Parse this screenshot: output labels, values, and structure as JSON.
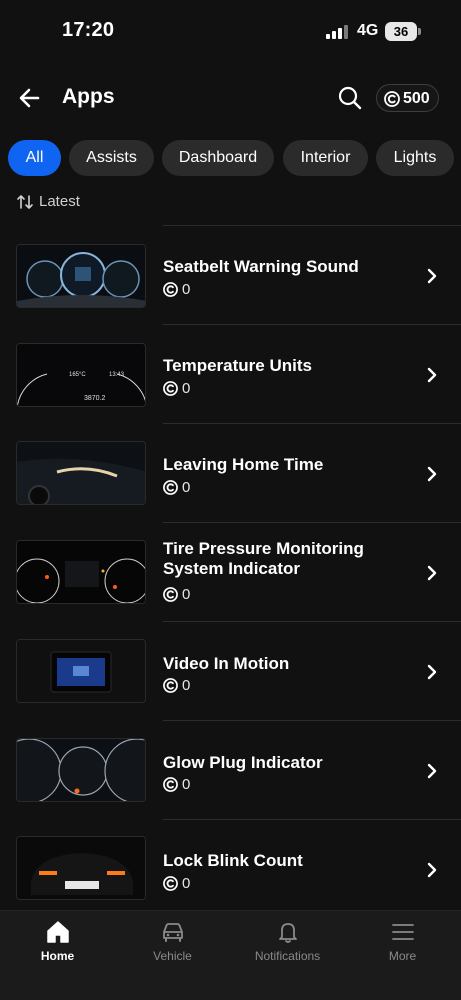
{
  "status_bar": {
    "time": "17:20",
    "network": "4G",
    "battery": "36"
  },
  "header": {
    "title": "Apps",
    "credits": "500",
    "icons": [
      "back-arrow-icon",
      "search-icon",
      "coin-icon"
    ]
  },
  "filters": [
    {
      "label": "All",
      "active": true
    },
    {
      "label": "Assists",
      "active": false
    },
    {
      "label": "Dashboard",
      "active": false
    },
    {
      "label": "Interior",
      "active": false
    },
    {
      "label": "Lights",
      "active": false
    }
  ],
  "sort": {
    "label": "Latest",
    "icon": "sort-arrows-icon"
  },
  "apps": [
    {
      "title": "Seatbelt Warning Sound",
      "price": "0"
    },
    {
      "title": "Temperature Units",
      "price": "0",
      "thumb_text": [
        "165°C",
        "13:43",
        "3870.2"
      ]
    },
    {
      "title": "Leaving Home Time",
      "price": "0"
    },
    {
      "title": "Tire Pressure Monitoring System Indicator",
      "price": "0"
    },
    {
      "title": "Video In Motion",
      "price": "0"
    },
    {
      "title": "Glow Plug Indicator",
      "price": "0"
    },
    {
      "title": "Lock  Blink  Count",
      "price": "0"
    }
  ],
  "bottom_nav": [
    {
      "label": "Home",
      "icon": "home-icon",
      "active": true
    },
    {
      "label": "Vehicle",
      "icon": "car-icon",
      "active": false
    },
    {
      "label": "Notifications",
      "icon": "bell-icon",
      "active": false
    },
    {
      "label": "More",
      "icon": "menu-icon",
      "active": false
    }
  ],
  "colors": {
    "accent": "#1064f2",
    "background": "#111111",
    "chip": "#2b2b2b",
    "nav_background": "#1b1b1b"
  }
}
